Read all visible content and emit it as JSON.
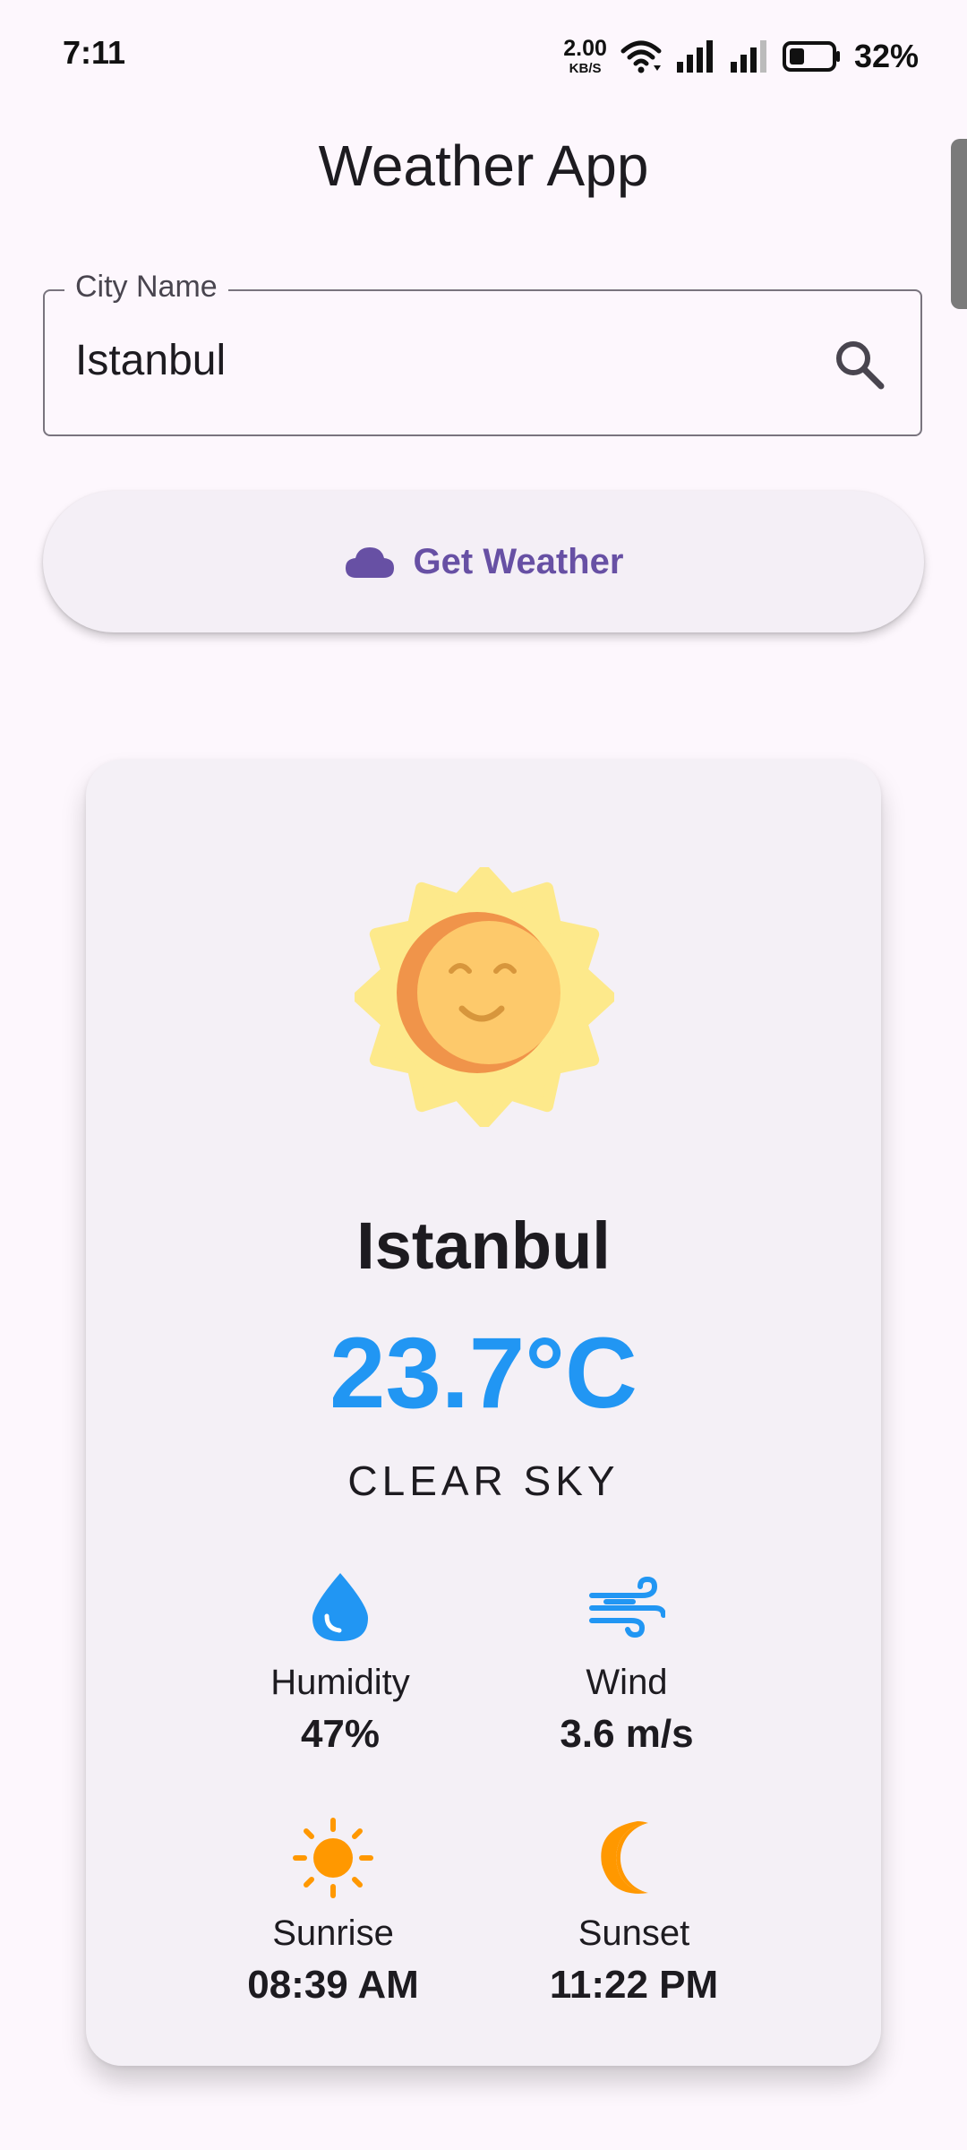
{
  "status_bar": {
    "time": "7:11",
    "net_speed_value": "2.00",
    "net_speed_unit": "KB/S",
    "battery_percent": "32%"
  },
  "app": {
    "title": "Weather App"
  },
  "search": {
    "label": "City Name",
    "value": "Istanbul"
  },
  "actions": {
    "get_weather_label": "Get Weather"
  },
  "weather": {
    "city": "Istanbul",
    "temperature": "23.7°C",
    "condition": "CLEAR SKY",
    "humidity_label": "Humidity",
    "humidity_value": "47%",
    "wind_label": "Wind",
    "wind_value": "3.6 m/s",
    "sunrise_label": "Sunrise",
    "sunrise_value": "08:39 AM",
    "sunset_label": "Sunset",
    "sunset_value": "11:22 PM"
  },
  "icons": {
    "search": "search-icon",
    "cloud": "cloud-icon",
    "weather": "sun-face-icon",
    "humidity": "water-drop-icon",
    "wind": "wind-icon",
    "sunrise": "sun-icon",
    "sunset": "moon-icon"
  },
  "colors": {
    "accent": "#6750a4",
    "temperature": "#2196f3",
    "sunrise": "#ff9800",
    "sunset": "#ff9800"
  }
}
